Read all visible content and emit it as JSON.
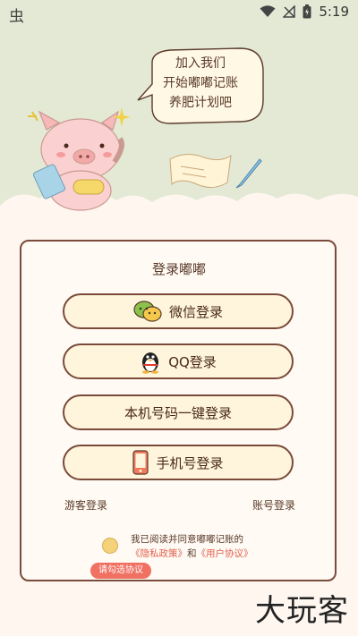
{
  "statusbar": {
    "app_glyph": "虫",
    "time": "5:19",
    "icons": [
      "wifi-icon",
      "signal-off-icon",
      "battery-charging-icon"
    ]
  },
  "bubble": {
    "line1": "加入我们",
    "line2": "开始嘟嘟记账",
    "line3": "养肥计划吧"
  },
  "login": {
    "title": "登录嘟嘟",
    "buttons": [
      {
        "label": "微信登录",
        "icon": "wechat-icon"
      },
      {
        "label": "QQ登录",
        "icon": "qq-penguin-icon"
      },
      {
        "label": "本机号码一键登录",
        "icon": ""
      },
      {
        "label": "手机号登录",
        "icon": "phone-icon"
      }
    ],
    "guest_label": "游客登录",
    "account_label": "账号登录"
  },
  "agreement": {
    "text": "我已阅读并同意嘟嘟记账的",
    "privacy": "《隐私政策》",
    "and": "和",
    "terms": "《用户协议》",
    "tooltip": "请勾选协议"
  },
  "watermark": "大玩客",
  "colors": {
    "header_bg": "#E4E9D6",
    "page_bg": "#FEF6EF",
    "border": "#7A4A3A",
    "button_bg": "#FFF5DC",
    "accent_red": "#E06050"
  }
}
